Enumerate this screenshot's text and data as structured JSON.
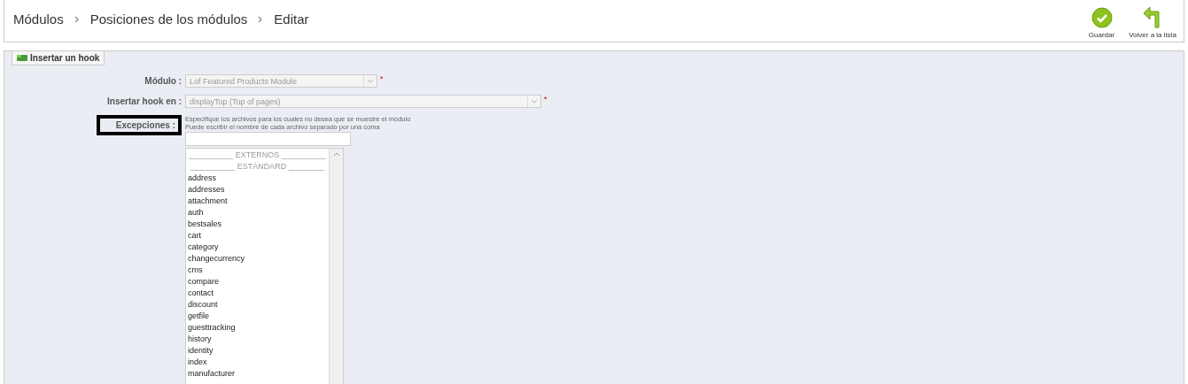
{
  "breadcrumb": [
    "Módulos",
    "Posiciones de los módulos",
    "Editar"
  ],
  "toolbar": [
    {
      "kind": "save",
      "label": "Guardar"
    },
    {
      "kind": "back",
      "label": "Volver a la lista"
    }
  ],
  "fieldset": {
    "legend": "Insertar un hook",
    "fields": [
      {
        "kind": "select",
        "label": "Módulo :",
        "value": "Lof Featured Products Module",
        "disabled": true,
        "required": "*",
        "wide": false
      },
      {
        "kind": "select",
        "label": "Insertar hook en :",
        "value": "displayTop (Top of pages)",
        "disabled": true,
        "required": "*",
        "wide": true
      }
    ],
    "exceptions": {
      "label": "Excepciones :",
      "highlighted": true,
      "help": [
        "Especifique los archivos para los cuales no desea que se muestre el módulo",
        "Puede escribir el nombre de cada archivo separado por una coma"
      ],
      "options": [
        {
          "kind": "group",
          "text": "__________ EXTERNOS __________"
        },
        {
          "kind": "group",
          "text": "__________ ESTÁNDARD ________"
        },
        {
          "kind": "item",
          "text": "address"
        },
        {
          "kind": "item",
          "text": "addresses"
        },
        {
          "kind": "item",
          "text": "attachment"
        },
        {
          "kind": "item",
          "text": "auth"
        },
        {
          "kind": "item",
          "text": "bestsales"
        },
        {
          "kind": "item",
          "text": "cart"
        },
        {
          "kind": "item",
          "text": "category"
        },
        {
          "kind": "item",
          "text": "changecurrency"
        },
        {
          "kind": "item",
          "text": "cms"
        },
        {
          "kind": "item",
          "text": "compare"
        },
        {
          "kind": "item",
          "text": "contact"
        },
        {
          "kind": "item",
          "text": "discount"
        },
        {
          "kind": "item",
          "text": "getfile"
        },
        {
          "kind": "item",
          "text": "guesttracking"
        },
        {
          "kind": "item",
          "text": "history"
        },
        {
          "kind": "item",
          "text": "identity"
        },
        {
          "kind": "item",
          "text": "index"
        },
        {
          "kind": "item",
          "text": "manufacturer"
        }
      ]
    }
  }
}
